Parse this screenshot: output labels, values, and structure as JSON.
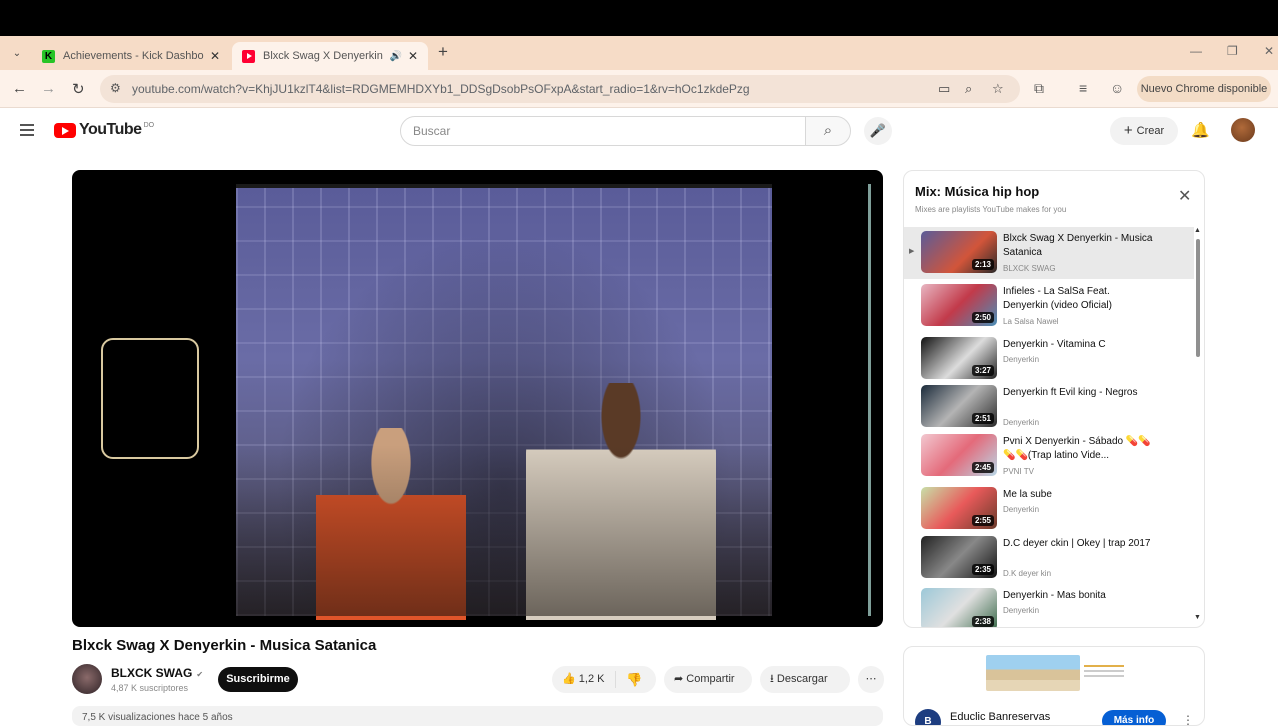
{
  "browser": {
    "tabs": [
      {
        "label": "Achievements - Kick Dashboard",
        "icon": "kick-icon"
      },
      {
        "label": "Blxck Swag X Denyerkin - Sr",
        "icon": "youtube-icon",
        "active": true
      }
    ],
    "url": "youtube.com/watch?v=KhjJU1kzlT4&list=RDGMEMHDXYb1_DDSgDsobPsOFxpA&start_radio=1&rv=hOc1zkdePzg",
    "update_label": "Nuevo Chrome disponible"
  },
  "yt_header": {
    "logo": "YouTube",
    "country": "DO",
    "search_placeholder": "Buscar",
    "create_label": "Crear"
  },
  "video": {
    "title": "Blxck Swag X Denyerkin - Musica Satanica",
    "channel": "BLXCK SWAG",
    "subscribers": "4,87 K suscriptores",
    "subscribe_label": "Suscribirme",
    "likes": "1,2 K",
    "share_label": "Compartir",
    "download_label": "Descargar",
    "description_preview": "7,5 K visualizaciones  hace 5 años"
  },
  "playlist": {
    "title": "Mix: Música hip hop",
    "subtitle": "Mixes are playlists YouTube makes for you",
    "items": [
      {
        "title": "Blxck Swag X Denyerkin - Musica Satanica",
        "channel": "BLXCK SWAG",
        "duration": "2:13",
        "active": true
      },
      {
        "title": "Infieles - La SalSa Feat. Denyerkin (video Oficial)",
        "channel": "La Salsa Nawel",
        "duration": "2:50"
      },
      {
        "title": "Denyerkin - Vitamina C",
        "channel": "Denyerkin",
        "duration": "3:27"
      },
      {
        "title": "Denyerkin ft Evil king - Negros",
        "channel": "Denyerkin",
        "duration": "2:51"
      },
      {
        "title": "Pvni X Denyerkin - Sábado 💊💊💊💊(Trap latino Vide...",
        "channel": "PVNI TV",
        "duration": "2:45"
      },
      {
        "title": "Me la sube",
        "channel": "Denyerkin",
        "duration": "2:55"
      },
      {
        "title": "D.C deyer ckin | Okey | trap 2017",
        "channel": "D.K deyer kin",
        "duration": "2:35"
      },
      {
        "title": "Denyerkin - Mas bonita",
        "channel": "Denyerkin",
        "duration": "2:38"
      }
    ]
  },
  "ad": {
    "advertiser": "Educlic Banreservas",
    "cta": "Más info"
  }
}
